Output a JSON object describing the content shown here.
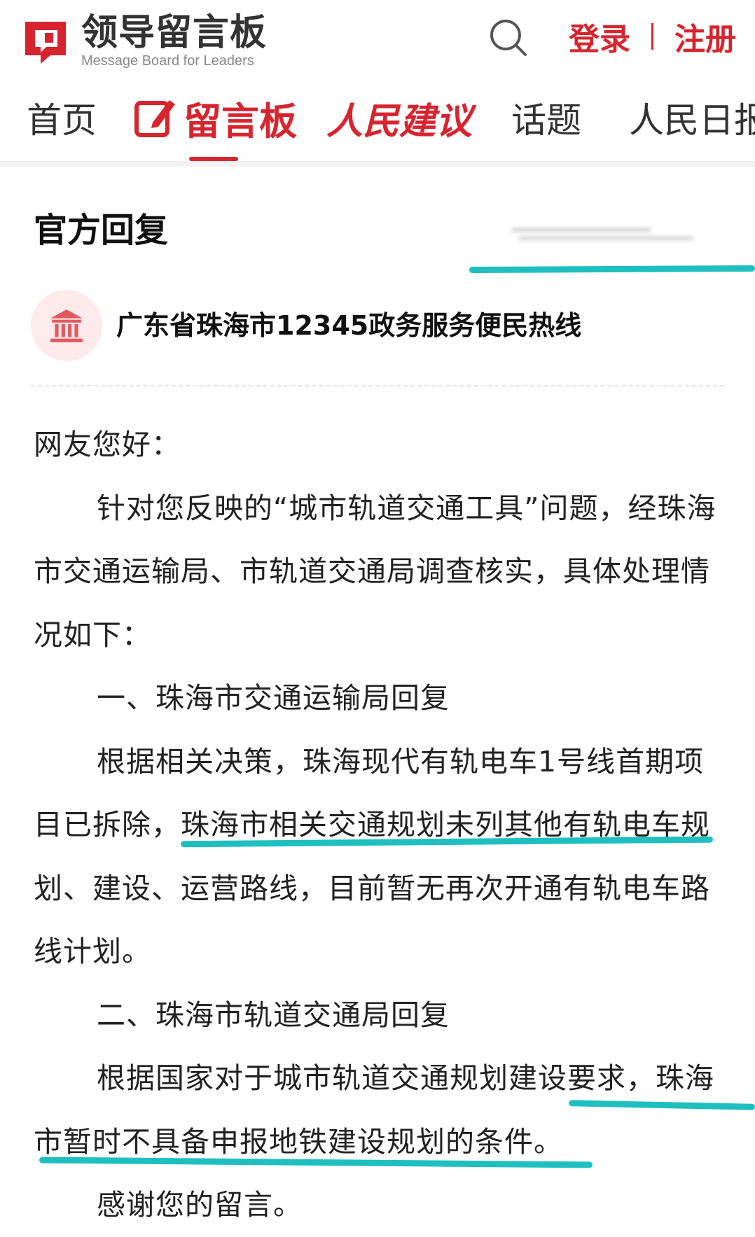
{
  "header": {
    "logo_title": "领导留言板",
    "logo_subtitle": "Message Board for Leaders",
    "login_label": "登录",
    "register_label": "注册"
  },
  "nav": {
    "home": "首页",
    "board": "留言板",
    "suggest": "人民建议",
    "topic": "话题",
    "daily": "人民日报"
  },
  "reply": {
    "section_title": "官方回复",
    "department": "广东省珠海市12345政务服务便民热线"
  },
  "content": {
    "greeting": "网友您好：",
    "intro": "针对您反映的“城市轨道交通工具”问题，经珠海市交通运输局、市轨道交通局调查核实，具体处理情况如下：",
    "part1_heading": "一、珠海市交通运输局回复",
    "part1_body": "根据相关决策，珠海现代有轨电车1号线首期项目已拆除，珠海市相关交通规划未列其他有轨电车规划、建设、运营路线，目前暂无再次开通有轨电车路线计划。",
    "part2_heading": "二、珠海市轨道交通局回复",
    "part2_body": "根据国家对于城市轨道交通规划建设要求，珠海市暂时不具备申报地铁建设规划的条件。",
    "thanks": "感谢您的留言。"
  },
  "colors": {
    "brand_red": "#d6252e",
    "marker_teal": "#1fbfc0",
    "avatar_bg": "#fdeaea"
  },
  "icons": {
    "logo": "message-board-logo-icon",
    "search": "search-icon",
    "board": "edit-note-icon",
    "department": "government-building-icon"
  }
}
